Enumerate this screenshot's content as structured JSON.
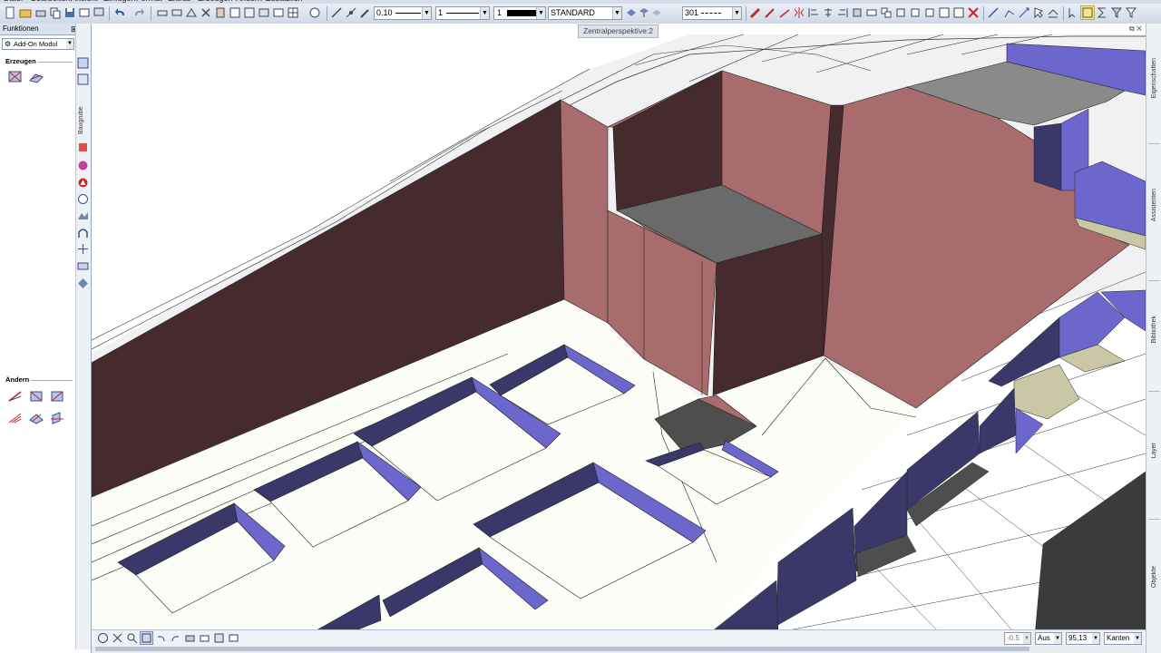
{
  "toolbar": {
    "pen_thickness": "0.10",
    "line_type": "1",
    "color_number": "1",
    "layer": "STANDARD",
    "line_style": "301"
  },
  "left_panel": {
    "title": "Funktionen",
    "module": "Add-On Modul",
    "section_create": "Erzeugen",
    "section_modify": "Ändern",
    "vertical_tab": "Baugrube"
  },
  "viewport": {
    "title": "Zentralperspektive:2"
  },
  "right_tabs": [
    "Eigenschaften",
    "Assistenten",
    "Bibliothek",
    "Layer",
    "Objekte"
  ],
  "statusbar": {
    "offset_value": "-0.5",
    "mode_value": "Aus",
    "angle_value": "95,13",
    "display_mode": "Kanten"
  },
  "colors": {
    "wall_dark": "#452a2e",
    "wall_light": "#a96c6c",
    "pit_side_light": "#6b67cc",
    "pit_side_dark": "#3a3868",
    "floor": "#fdfdf8",
    "terrain": "#f1f1f3"
  }
}
